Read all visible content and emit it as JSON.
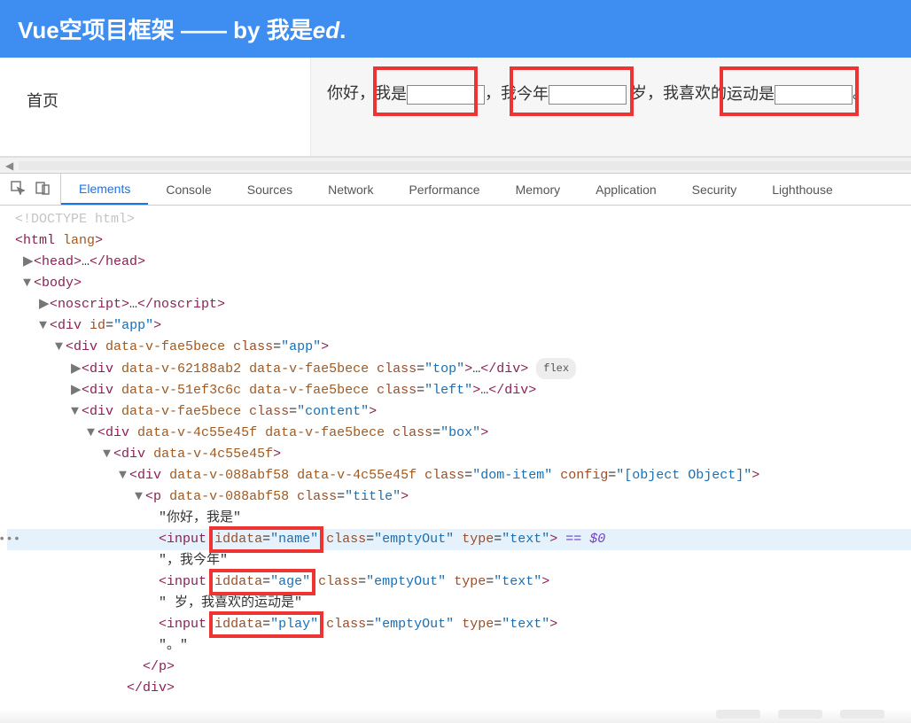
{
  "header": {
    "title_prefix": "Vue空项目框架 —— by 我是",
    "title_italic": "ed",
    "title_suffix": "."
  },
  "nav": {
    "home": "首页"
  },
  "form": {
    "t1": "你好，我",
    "t2": "是",
    "t3": "，我",
    "t4": "今年",
    "t5": " 岁，我喜欢的",
    "t6": "运动是",
    "t7": "。",
    "name_value": "",
    "age_value": "",
    "play_value": ""
  },
  "devtools": {
    "tabs": [
      "Elements",
      "Console",
      "Sources",
      "Network",
      "Performance",
      "Memory",
      "Application",
      "Security",
      "Lighthouse"
    ],
    "active_tab_index": 0
  },
  "code": {
    "l1": "<!DOCTYPE html>",
    "l2": {
      "open": "<",
      "tag": "html",
      "attr": " lang",
      "close": ">"
    },
    "l3": {
      "open": "<",
      "tag": "head",
      "mid": ">…</",
      "close": ">"
    },
    "l4": {
      "open": "<",
      "tag": "body",
      "close": ">"
    },
    "l5": {
      "open": "<",
      "tag": "noscript",
      "mid": ">…</",
      "close": ">"
    },
    "l6": {
      "open": "<",
      "tag": "div",
      "attrs": [
        [
          "id",
          "app"
        ]
      ],
      "close": ">"
    },
    "l7": {
      "open": "<",
      "tag": "div",
      "dv": "data-v-fae5bece",
      "attrs": [
        [
          "class",
          "app"
        ]
      ],
      "close": ">"
    },
    "l8": {
      "open": "<",
      "tag": "div",
      "dv": "data-v-62188ab2 data-v-fae5bece",
      "attrs": [
        [
          "class",
          "top"
        ]
      ],
      "mid": ">…</",
      "close": ">",
      "badge": "flex"
    },
    "l9": {
      "open": "<",
      "tag": "div",
      "dv": "data-v-51ef3c6c data-v-fae5bece",
      "attrs": [
        [
          "class",
          "left"
        ]
      ],
      "mid": ">…</",
      "close": ">"
    },
    "l10": {
      "open": "<",
      "tag": "div",
      "dv": "data-v-fae5bece",
      "attrs": [
        [
          "class",
          "content"
        ]
      ],
      "close": ">"
    },
    "l11": {
      "open": "<",
      "tag": "div",
      "dv": "data-v-4c55e45f data-v-fae5bece",
      "attrs": [
        [
          "class",
          "box"
        ]
      ],
      "close": ">"
    },
    "l12": {
      "open": "<",
      "tag": "div",
      "dv": "data-v-4c55e45f",
      "close": ">"
    },
    "l13": {
      "open": "<",
      "tag": "div",
      "dv": "data-v-088abf58 data-v-4c55e45f",
      "attrs": [
        [
          "class",
          "dom-item"
        ],
        [
          "config",
          "[object Object]"
        ]
      ],
      "close": ">"
    },
    "l14": {
      "open": "<",
      "tag": "p",
      "dv": "data-v-088abf58",
      "attrs": [
        [
          "class",
          "title"
        ]
      ],
      "close": ">"
    },
    "l15": "\"你好，我是\"",
    "l16": {
      "open": "<",
      "tag": "input",
      "hlattr": [
        "iddata",
        "name"
      ],
      "attrs": [
        [
          "class",
          "emptyOut"
        ],
        [
          "type",
          "text"
        ]
      ],
      "close": ">",
      "eq": " == $0"
    },
    "l17": "\"，我今年\"",
    "l18": {
      "open": "<",
      "tag": "input",
      "hlattr": [
        "iddata",
        "age"
      ],
      "attrs": [
        [
          "class",
          "emptyOut"
        ],
        [
          "type",
          "text"
        ]
      ],
      "close": ">"
    },
    "l19": "\" 岁，我喜欢的运动是\"",
    "l20": {
      "open": "<",
      "tag": "input",
      "hlattr": [
        "iddata",
        "play"
      ],
      "attrs": [
        [
          "class",
          "emptyOut"
        ],
        [
          "type",
          "text"
        ]
      ],
      "close": ">"
    },
    "l21": "\"。\"",
    "l22": {
      "open": "</",
      "tag": "p",
      "close": ">"
    },
    "l23": {
      "open": "</",
      "tag": "div",
      "close": ">"
    }
  }
}
